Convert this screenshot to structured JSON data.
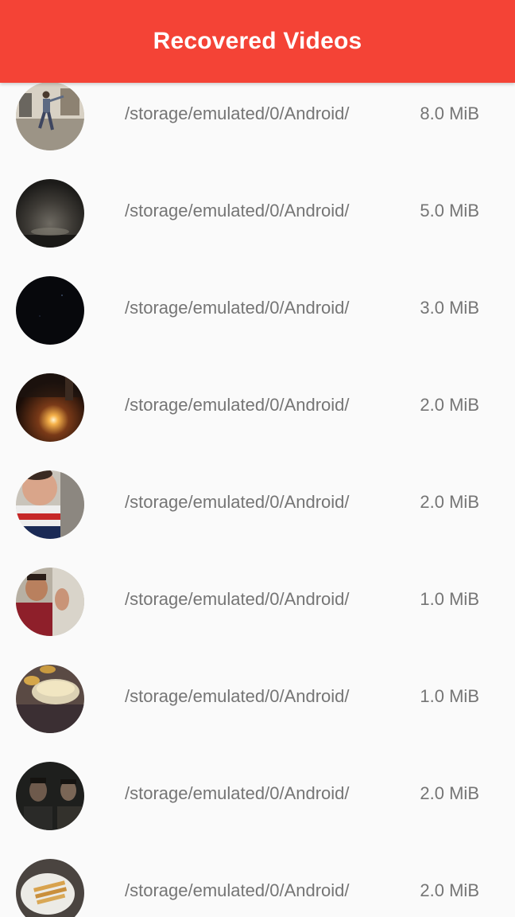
{
  "app_bar": {
    "title": "Recovered Videos",
    "color": "#f44336"
  },
  "videos": [
    {
      "path": "/storage/emulated/0/Android/",
      "size": "8.0 MiB",
      "thumbnail": "man-dancing-indoors"
    },
    {
      "path": "/storage/emulated/0/Android/",
      "size": "5.0 MiB",
      "thumbnail": "dim-horizon-glow"
    },
    {
      "path": "/storage/emulated/0/Android/",
      "size": "3.0 MiB",
      "thumbnail": "dark-night"
    },
    {
      "path": "/storage/emulated/0/Android/",
      "size": "2.0 MiB",
      "thumbnail": "fire-at-night"
    },
    {
      "path": "/storage/emulated/0/Android/",
      "size": "2.0 MiB",
      "thumbnail": "child-closeup"
    },
    {
      "path": "/storage/emulated/0/Android/",
      "size": "1.0 MiB",
      "thumbnail": "man-waving"
    },
    {
      "path": "/storage/emulated/0/Android/",
      "size": "1.0 MiB",
      "thumbnail": "food-bowls"
    },
    {
      "path": "/storage/emulated/0/Android/",
      "size": "2.0 MiB",
      "thumbnail": "two-men-dark"
    },
    {
      "path": "/storage/emulated/0/Android/",
      "size": "2.0 MiB",
      "thumbnail": "plate-of-food"
    }
  ]
}
